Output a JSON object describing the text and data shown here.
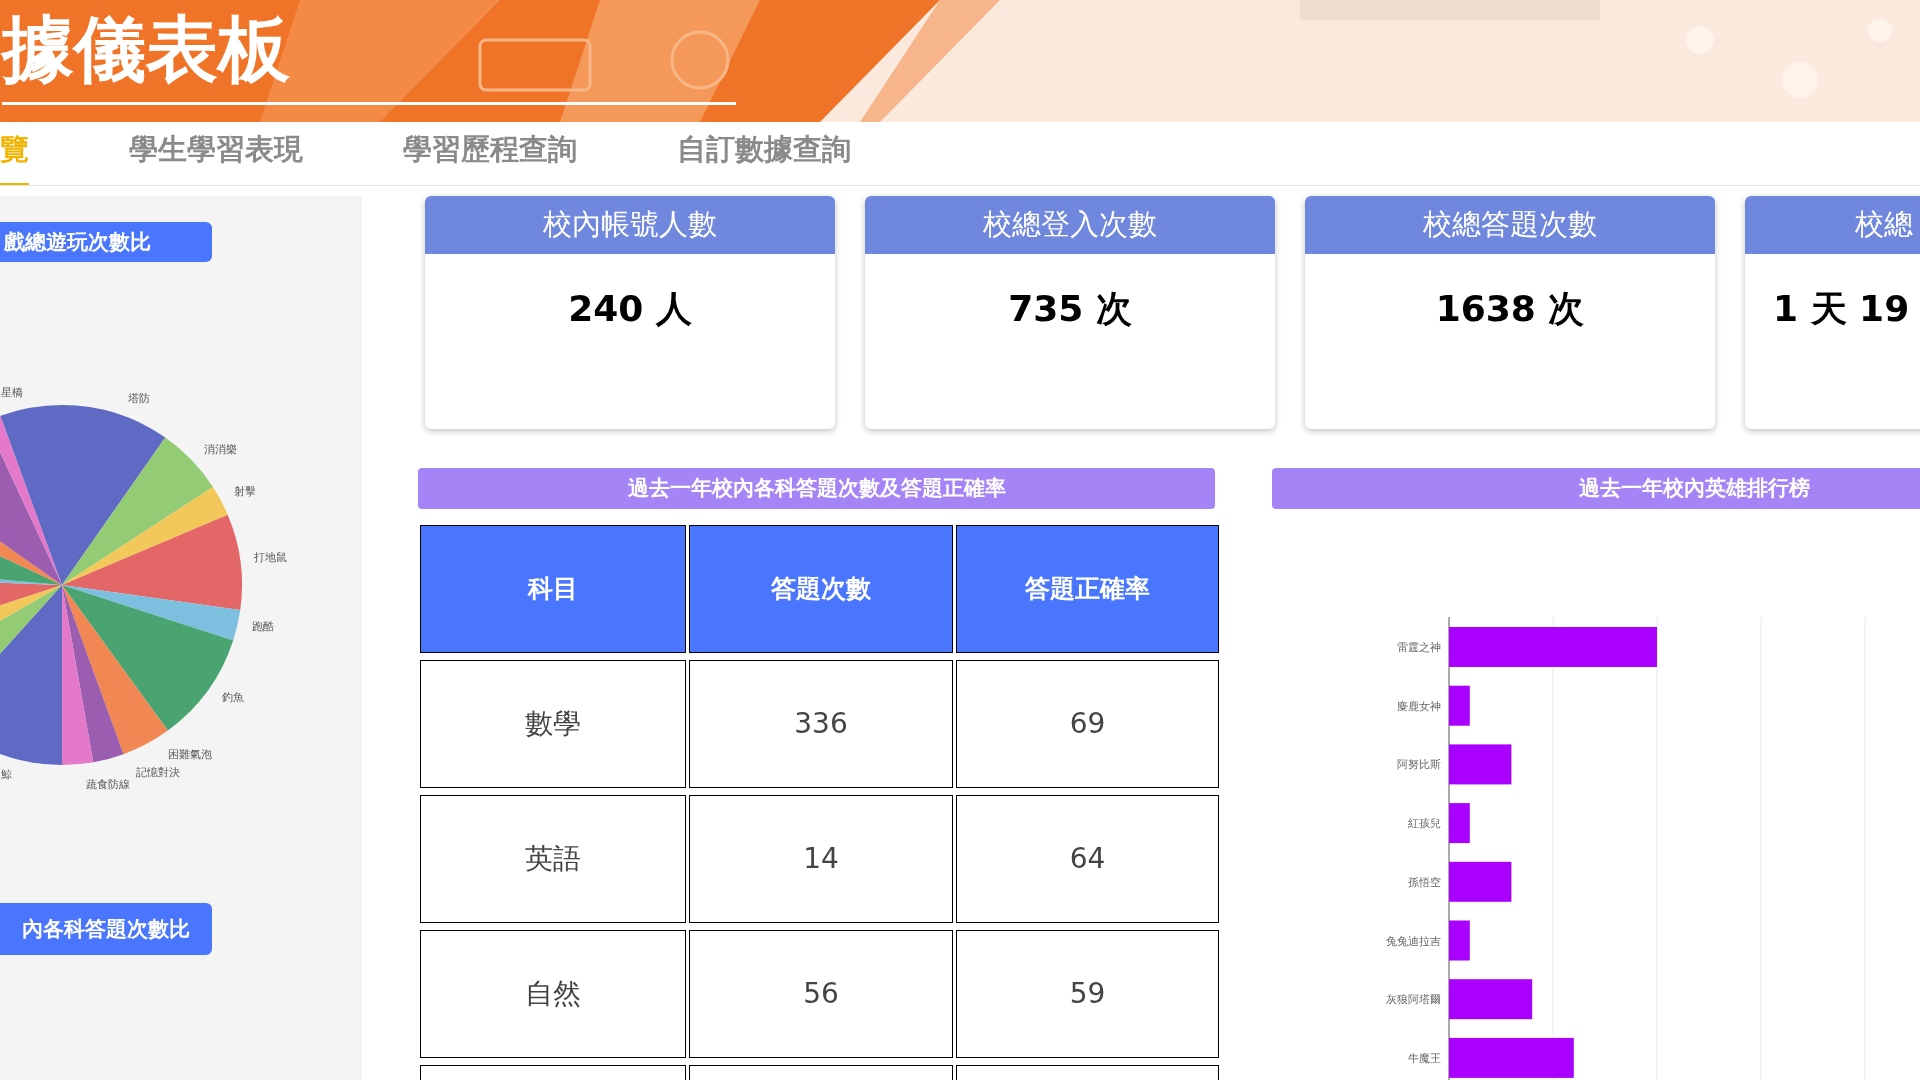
{
  "header": {
    "title": "據儀表板"
  },
  "tabs": [
    {
      "label": "覽",
      "selected": true
    },
    {
      "label": "學生學習表現",
      "selected": false
    },
    {
      "label": "學習歷程查詢",
      "selected": false
    },
    {
      "label": "自訂數據查詢",
      "selected": false
    }
  ],
  "sidebar": {
    "sections": [
      {
        "title": "戲總遊玩次數比"
      },
      {
        "title": "內各科答題次數比"
      }
    ],
    "pie_labels": [
      "星橋",
      "塔防",
      "消消樂",
      "射擊",
      "打地鼠",
      "跑酷",
      "釣魚",
      "困難氣泡",
      "記憶對決",
      "蔬食防線",
      "鯨"
    ]
  },
  "stat_cards": [
    {
      "title": "校內帳號人數",
      "value": "240 人"
    },
    {
      "title": "校總登入次數",
      "value": "735 次"
    },
    {
      "title": "校總答題次數",
      "value": "1638 次"
    },
    {
      "title": "校總",
      "value": "1 天 19"
    }
  ],
  "subject_table": {
    "title": "過去一年校內各科答題次數及答題正確率",
    "columns": [
      "科目",
      "答題次數",
      "答題正確率"
    ],
    "rows": [
      [
        "數學",
        "336",
        "69"
      ],
      [
        "英語",
        "14",
        "64"
      ],
      [
        "自然",
        "56",
        "59"
      ]
    ]
  },
  "hero_ranking": {
    "title": "過去一年校內英雄排行榜",
    "labels": [
      "雷霆之神",
      "麋鹿女神",
      "阿努比斯",
      "紅孩兒",
      "孫悟空",
      "兔兔迪拉吉",
      "灰狼阿塔爾",
      "牛魔王"
    ]
  }
}
